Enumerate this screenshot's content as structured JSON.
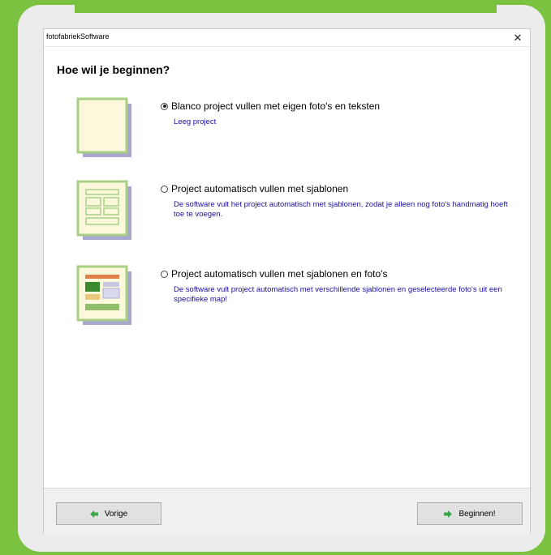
{
  "window": {
    "title": "fotofabriekSoftware",
    "close_glyph": "✕"
  },
  "heading": "Hoe wil je beginnen?",
  "options": [
    {
      "label": "Blanco project vullen met eigen foto's en teksten",
      "description": "Leeg project",
      "selected": true,
      "icon": "blank-page-icon"
    },
    {
      "label": "Project automatisch vullen met sjablonen",
      "description": "De software vult het project automatisch met sjablonen, zodat je alleen nog foto's handmatig hoeft toe te voegen.",
      "selected": false,
      "icon": "template-page-icon"
    },
    {
      "label": "Project automatisch vullen met sjablonen en foto's",
      "description": "De software vult project automatisch met verschillende sjablonen en geselecteerde foto's uit een specifieke map!",
      "selected": false,
      "icon": "template-photos-page-icon"
    }
  ],
  "footer": {
    "back_label": "Vorige",
    "next_label": "Beginnen!"
  },
  "colors": {
    "brand_green": "#7bc241",
    "description_blue": "#1a0fa8",
    "thumb_fill": "#fbf8dc",
    "thumb_border": "#a9cf86",
    "thumb_shadow": "#a7a7cf"
  }
}
